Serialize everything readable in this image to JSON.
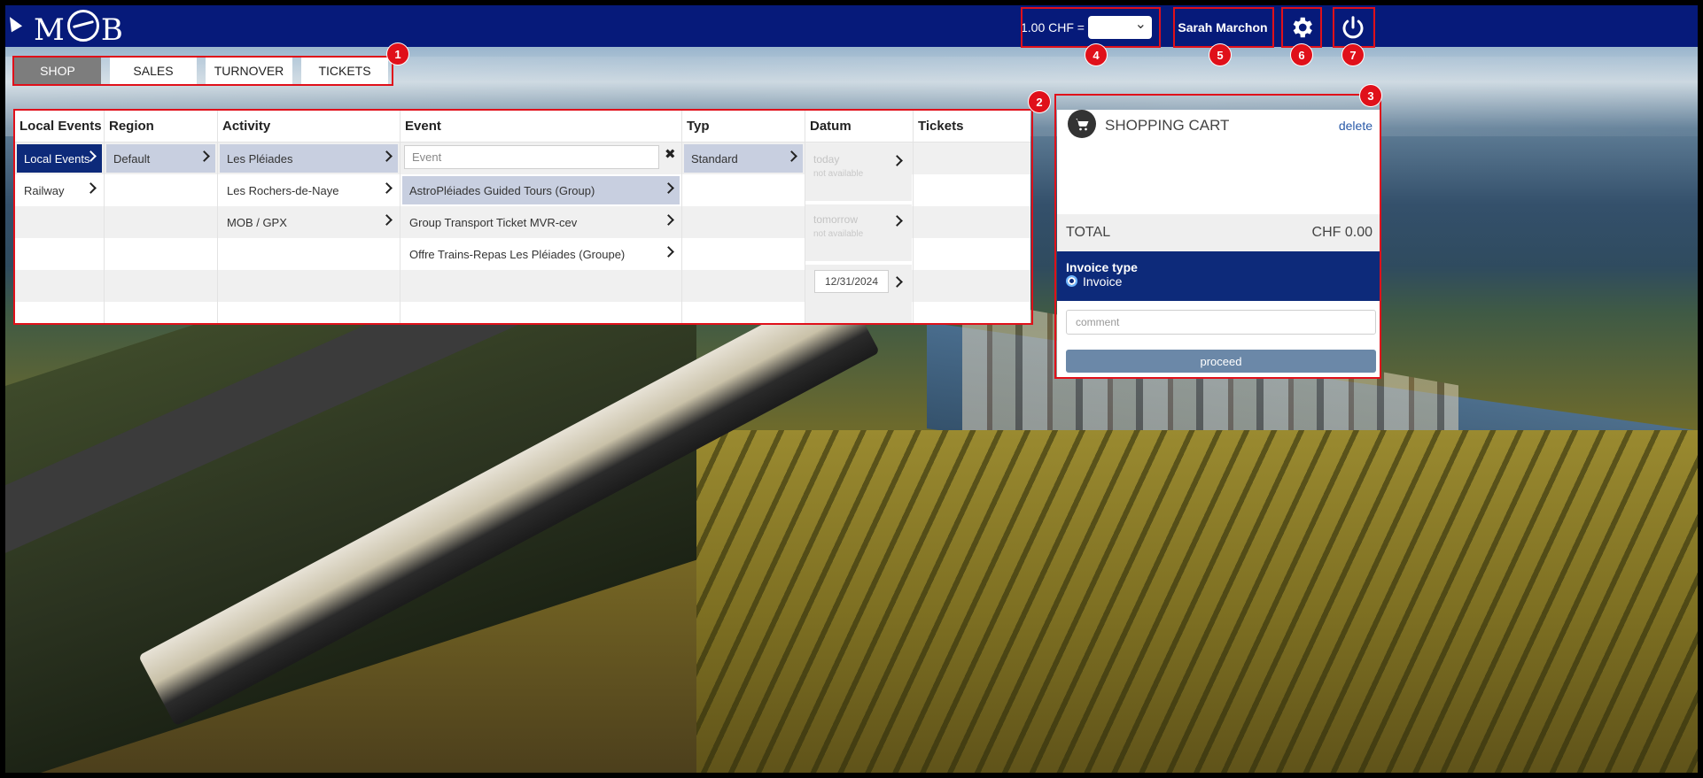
{
  "app": {
    "logo": "MOB"
  },
  "header": {
    "rate_label": "1.00 CHF =",
    "currency_selected": "",
    "user_name": "Sarah Marchon",
    "settings_icon": "gear-icon",
    "logout_icon": "power-icon"
  },
  "tabs": [
    {
      "label": "SHOP",
      "active": true
    },
    {
      "label": "SALES",
      "active": false
    },
    {
      "label": "TURNOVER",
      "active": false
    },
    {
      "label": "TICKETS",
      "active": false
    }
  ],
  "table": {
    "headers": {
      "local_events": "Local Events",
      "region": "Region",
      "activity": "Activity",
      "event": "Event",
      "typ": "Typ",
      "datum": "Datum",
      "tickets": "Tickets"
    },
    "local_events": [
      "Local Events",
      "Railway"
    ],
    "regions": [
      "Default"
    ],
    "activities": [
      "Les Pléiades",
      "Les Rochers-de-Naye",
      "MOB / GPX"
    ],
    "event_placeholder": "Event",
    "events": [
      "AstroPléiades Guided Tours (Group)",
      "Group Transport Ticket MVR-cev",
      "Offre Trains-Repas Les Pléiades (Groupe)"
    ],
    "types": [
      "Standard"
    ],
    "datum": {
      "today": "today",
      "tomorrow": "tomorrow",
      "not_available": "not available",
      "custom_date": "12/31/2024"
    }
  },
  "cart": {
    "title": "SHOPPING CART",
    "delete_label": "delete",
    "total_label": "TOTAL",
    "total_value": "CHF 0.00",
    "invoice_type_label": "Invoice type",
    "invoice_option": "Invoice",
    "comment_placeholder": "comment",
    "proceed_label": "proceed"
  },
  "markers": [
    "1",
    "2",
    "3",
    "4",
    "5",
    "6",
    "7"
  ],
  "colors": {
    "header": "#061a7a",
    "selected_dark": "#0d2a7a",
    "selected_light": "#c8cfe0",
    "annotation_red": "#e0101a",
    "proceed": "#6b88a8"
  }
}
